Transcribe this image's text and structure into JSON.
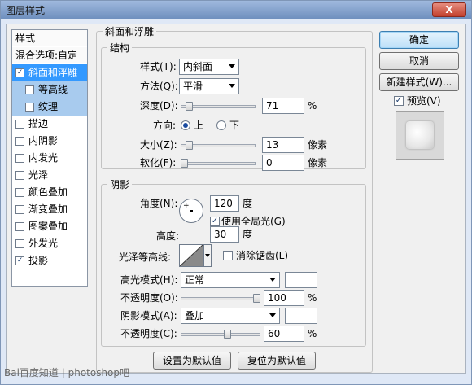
{
  "window": {
    "title": "图层样式",
    "close": "X"
  },
  "left_list": {
    "header": "样式",
    "blend_options": "混合选项:自定",
    "items": [
      {
        "label": "斜面和浮雕",
        "checked": true
      },
      {
        "label": "等高线",
        "checked": false
      },
      {
        "label": "纹理",
        "checked": false
      },
      {
        "label": "描边",
        "checked": false
      },
      {
        "label": "内阴影",
        "checked": false
      },
      {
        "label": "内发光",
        "checked": false
      },
      {
        "label": "光泽",
        "checked": false
      },
      {
        "label": "颜色叠加",
        "checked": false
      },
      {
        "label": "渐变叠加",
        "checked": false
      },
      {
        "label": "图案叠加",
        "checked": false
      },
      {
        "label": "外发光",
        "checked": false
      },
      {
        "label": "投影",
        "checked": true
      }
    ]
  },
  "bevel": {
    "section": "斜面和浮雕",
    "structure": {
      "title": "结构",
      "style_label": "样式(T):",
      "style_value": "内斜面",
      "technique_label": "方法(Q):",
      "technique_value": "平滑",
      "depth_label": "深度(D):",
      "depth_value": "71",
      "depth_unit": "%",
      "direction_label": "方向:",
      "dir_up": "上",
      "dir_down": "下",
      "size_label": "大小(Z):",
      "size_value": "13",
      "size_unit": "像素",
      "soften_label": "软化(F):",
      "soften_value": "0",
      "soften_unit": "像素"
    },
    "shading": {
      "title": "阴影",
      "angle_label": "角度(N):",
      "angle_value": "120",
      "angle_unit": "度",
      "global_light": "使用全局光(G)",
      "altitude_label": "高度:",
      "altitude_value": "30",
      "altitude_unit": "度",
      "gloss_label": "光泽等高线:",
      "anti_alias": "消除锯齿(L)",
      "highlight_label": "高光模式(H):",
      "highlight_value": "正常",
      "highlight_opacity_label": "不透明度(O):",
      "highlight_opacity_value": "100",
      "shadow_label": "阴影模式(A):",
      "shadow_value": "叠加",
      "shadow_opacity_label": "不透明度(C):",
      "shadow_opacity_value": "60",
      "pct": "%"
    },
    "set_default": "设置为默认值",
    "reset_default": "复位为默认值"
  },
  "actions": {
    "ok": "确定",
    "cancel": "取消",
    "new_style": "新建样式(W)...",
    "preview": "预览(V)"
  },
  "watermark": "Bai百度知道 | photoshop吧",
  "levels": {
    "depth": 0.07,
    "size": 0.07,
    "soften": 0.0,
    "hi_opacity": 1.0,
    "sh_opacity": 0.6
  }
}
